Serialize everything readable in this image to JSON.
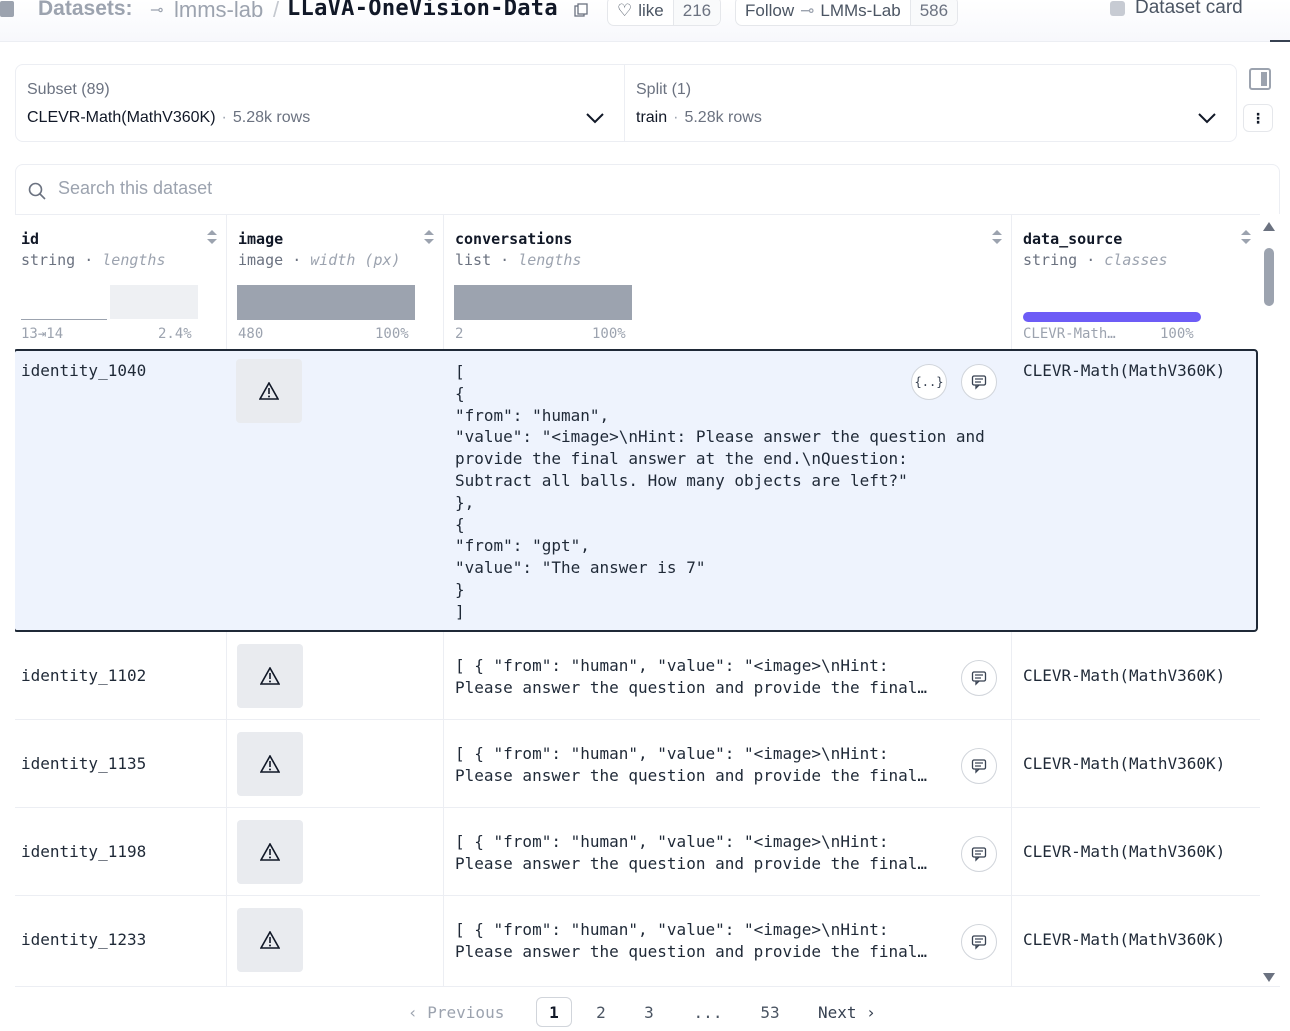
{
  "header": {
    "section_label": "Datasets:",
    "org": "lmms-lab",
    "separator": "/",
    "repo": "LLaVA-OneVision-Data",
    "like_label": "like",
    "like_count": "216",
    "follow_label": "Follow",
    "follow_org": "LMMs-Lab",
    "follow_count": "586",
    "dataset_card_label": "Dataset card"
  },
  "subset": {
    "caption": "Subset (89)",
    "value": "CLEVR-Math(MathV360K)",
    "dot": "·",
    "rows": "5.28k rows"
  },
  "split": {
    "caption": "Split (1)",
    "value": "train",
    "dot": "·",
    "rows": "5.28k rows"
  },
  "search": {
    "placeholder": "Search this dataset"
  },
  "columns": [
    {
      "name": "id",
      "type": "string",
      "stat": "lengths",
      "min": "13⇥14",
      "max": "2.4%"
    },
    {
      "name": "image",
      "type": "image",
      "stat": "width (px)",
      "min": "480",
      "max": "100%"
    },
    {
      "name": "conversations",
      "type": "list",
      "stat": "lengths",
      "min": "2",
      "max": "100%"
    },
    {
      "name": "data_source",
      "type": "string",
      "stat": "classes",
      "min": "CLEVR-Math…",
      "max": "100%"
    }
  ],
  "type_dot": "·",
  "rows": [
    {
      "id": "identity_1040",
      "conversations": "[\n{\n\"from\": \"human\",\n\"value\": \"<image>\\nHint: Please answer the question and\nprovide the final answer at the end.\\nQuestion:\nSubtract all balls. How many objects are left?\"\n},\n{\n\"from\": \"gpt\",\n\"value\": \"The answer is 7\"\n}\n]",
      "data_source": "CLEVR-Math(MathV360K)",
      "json_button": "{..}"
    },
    {
      "id": "identity_1102",
      "conversations": "[ { \"from\": \"human\", \"value\": \"<image>\\nHint:\nPlease answer the question and provide the final…",
      "data_source": "CLEVR-Math(MathV360K)"
    },
    {
      "id": "identity_1135",
      "conversations": "[ { \"from\": \"human\", \"value\": \"<image>\\nHint:\nPlease answer the question and provide the final…",
      "data_source": "CLEVR-Math(MathV360K)"
    },
    {
      "id": "identity_1198",
      "conversations": "[ { \"from\": \"human\", \"value\": \"<image>\\nHint:\nPlease answer the question and provide the final…",
      "data_source": "CLEVR-Math(MathV360K)"
    },
    {
      "id": "identity_1233",
      "conversations": "[ { \"from\": \"human\", \"value\": \"<image>\\nHint:\nPlease answer the question and provide the final…",
      "data_source": "CLEVR-Math(MathV360K)"
    }
  ],
  "pagination": {
    "prev": "‹ Previous",
    "pages": [
      "1",
      "2",
      "3",
      "...",
      "53"
    ],
    "next": "Next ›"
  },
  "icons": {
    "warning": "warning-triangle-icon",
    "comment": "comment-icon",
    "search": "search-icon",
    "chevron": "chevron-down-icon"
  },
  "colors": {
    "accent": "#6d5cf6",
    "selected_row_bg": "#eef3fd",
    "bar_gray": "#9ca3af"
  }
}
